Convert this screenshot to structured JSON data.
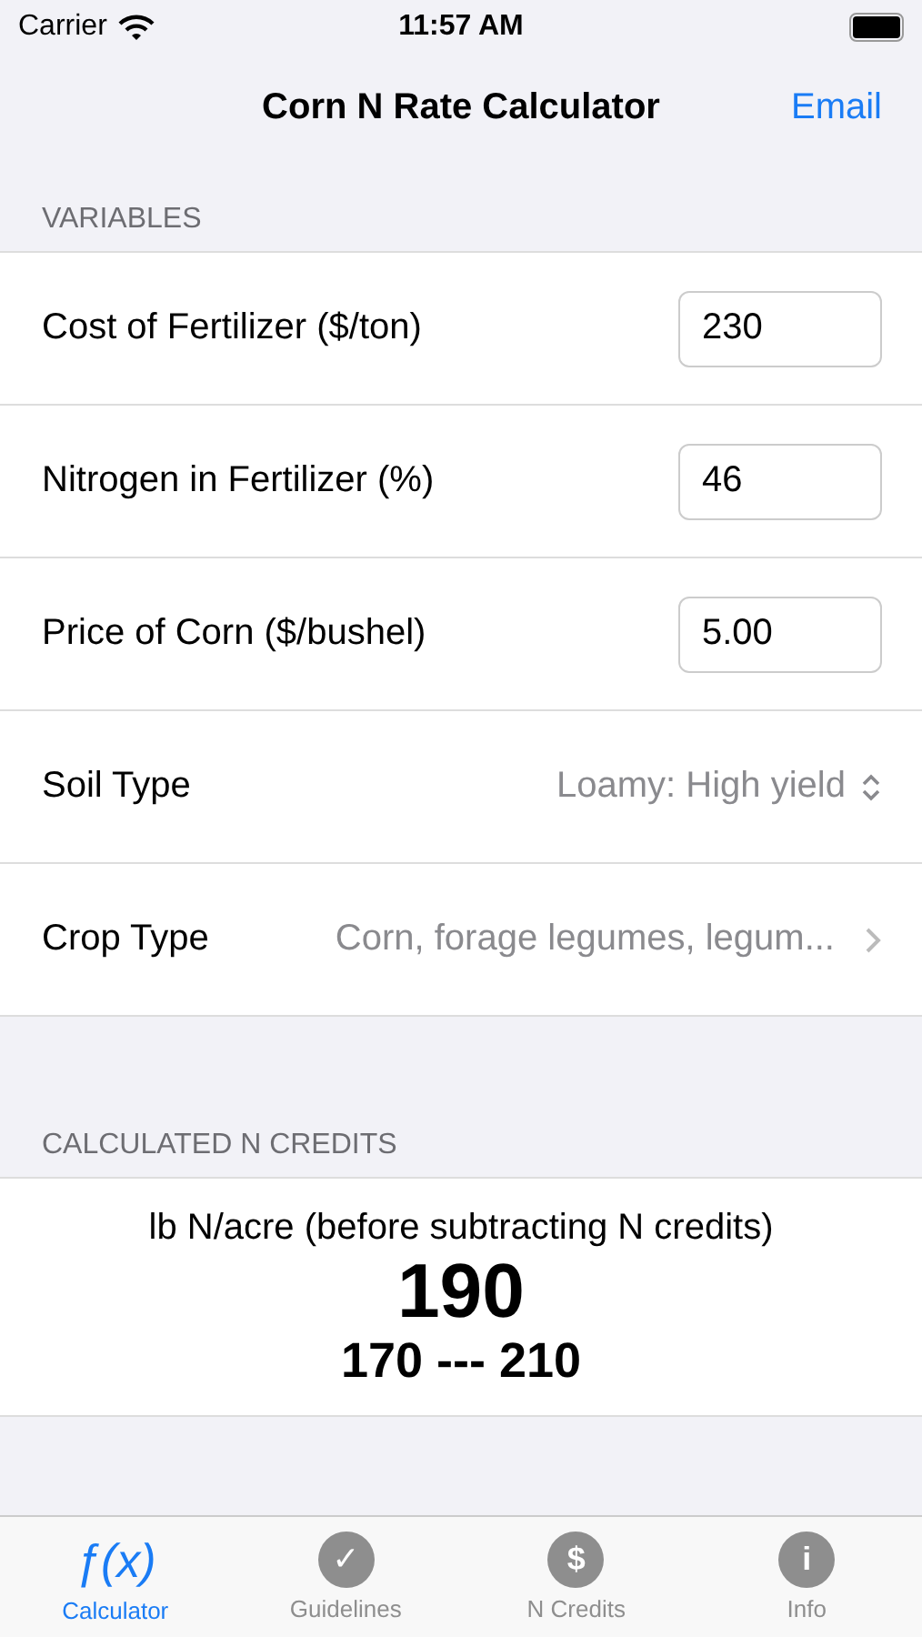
{
  "status_bar": {
    "carrier": "Carrier",
    "time": "11:57 AM"
  },
  "nav_bar": {
    "title": "Corn N Rate Calculator",
    "action": "Email"
  },
  "variables": {
    "header": "VARIABLES",
    "rows": [
      {
        "kind": "input",
        "label": "Cost of Fertilizer ($/ton)",
        "value": "230"
      },
      {
        "kind": "input",
        "label": "Nitrogen in Fertilizer (%)",
        "value": "46"
      },
      {
        "kind": "input",
        "label": "Price of Corn ($/bushel)",
        "value": "5.00"
      },
      {
        "kind": "select",
        "label": "Soil Type",
        "value": "Loamy: High yield"
      },
      {
        "kind": "nav",
        "label": "Crop Type",
        "value": "Corn, forage legumes, legum..."
      }
    ]
  },
  "credits": {
    "header": "CALCULATED N CREDITS",
    "caption": "lb N/acre (before subtracting N credits)",
    "rate": "190",
    "range": "170 --- 210"
  },
  "tabs": [
    {
      "kind": "plain",
      "glyph": "ƒ(x)",
      "label": "Calculator",
      "selected": true
    },
    {
      "kind": "circle",
      "glyph": "✓",
      "label": "Guidelines",
      "selected": false
    },
    {
      "kind": "circle",
      "glyph": "$",
      "label": "N Credits",
      "selected": false
    },
    {
      "kind": "circle",
      "glyph": "i",
      "label": "Info",
      "selected": false
    }
  ]
}
